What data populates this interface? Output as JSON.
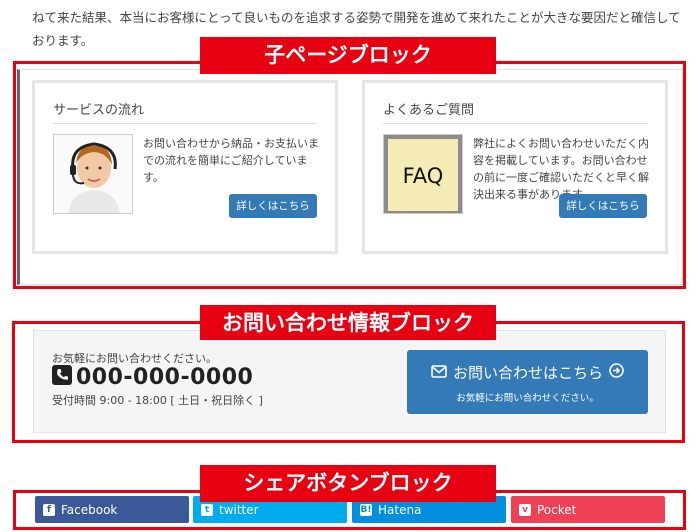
{
  "intro": {
    "text": "ねて来た結果、本当にお客様にとって良いものを追求する姿勢で開発を進めて来れたことが大きな要因だと確信しております。"
  },
  "labels": {
    "child_block": "子ページブロック",
    "contact_block": "お問い合わせ情報ブロック",
    "share_block": "シェアボタンブロック"
  },
  "cards": [
    {
      "title": "サービスの流れ",
      "text": "お問い合わせから納品・お支払いまでの流れを簡単にご紹介しています。",
      "button": "詳しくはこちら",
      "image": "support-operator-photo"
    },
    {
      "title": "よくあるご質問",
      "text": "弊社によくお問い合わせいただく内容を掲載しています。お問い合わせの前に一度ご確認いただくと早く解決出来る事があります。",
      "button": "詳しくはこちら",
      "image_text": "FAQ"
    }
  ],
  "contact": {
    "sub": "お気軽にお問い合わせください。",
    "phone": "000-000-0000",
    "hours": "受付時間 9:00 - 18:00 [ 土日・祝日除く ]",
    "button_main": "お問い合わせはこちら",
    "button_sub": "お気軽にお問い合わせください。",
    "icons": {
      "phone": "phone-icon",
      "mail": "envelope-icon",
      "arrow": "circle-arrow-right-icon"
    }
  },
  "share": [
    {
      "label": "Facebook",
      "color": "#3b5998",
      "icon": "facebook-icon"
    },
    {
      "label": "twitter",
      "color": "#00aced",
      "icon": "twitter-icon"
    },
    {
      "label": "Hatena",
      "color": "#008fde",
      "icon": "hatena-icon"
    },
    {
      "label": "Pocket",
      "color": "#ef4056",
      "icon": "pocket-icon"
    }
  ],
  "colors": {
    "accent_red": "#e60012",
    "button_blue": "#337ab7"
  }
}
